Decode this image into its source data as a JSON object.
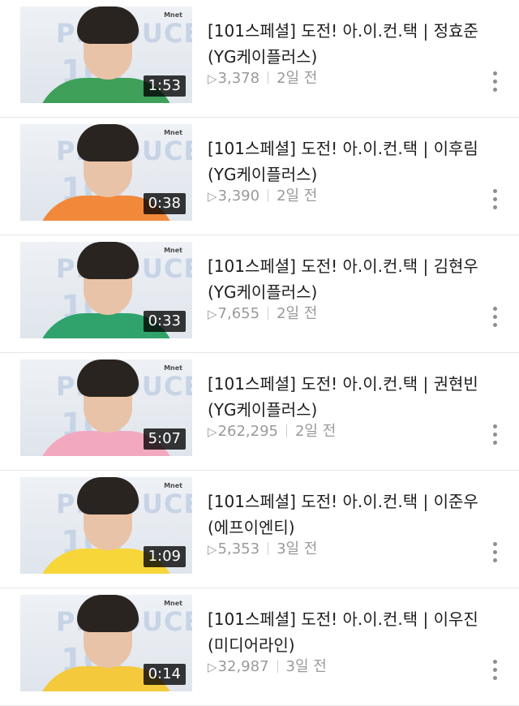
{
  "videos": [
    {
      "title": "[101스페셜] 도전! 아.이.컨.택 | 정효준 (YG케이플러스)",
      "duration": "1:53",
      "views": "3,378",
      "age": "2일 전",
      "shirt_color": "#3fa05a"
    },
    {
      "title": "[101스페셜] 도전! 아.이.컨.택 | 이후림 (YG케이플러스)",
      "duration": "0:38",
      "views": "3,390",
      "age": "2일 전",
      "shirt_color": "#f2893a"
    },
    {
      "title": "[101스페셜] 도전! 아.이.컨.택 | 김현우 (YG케이플러스)",
      "duration": "0:33",
      "views": "7,655",
      "age": "2일 전",
      "shirt_color": "#2fa36b"
    },
    {
      "title": "[101스페셜] 도전! 아.이.컨.택 | 권현빈 (YG케이플러스)",
      "duration": "5:07",
      "views": "262,295",
      "age": "2일 전",
      "shirt_color": "#f2a9c0"
    },
    {
      "title": "[101스페셜] 도전! 아.이.컨.택 | 이준우 (에프이엔티)",
      "duration": "1:09",
      "views": "5,353",
      "age": "3일 전",
      "shirt_color": "#f7d63a"
    },
    {
      "title": "[101스페셜] 도전! 아.이.컨.택 | 이우진 (미디어라인)",
      "duration": "0:14",
      "views": "32,987",
      "age": "3일 전",
      "shirt_color": "#f4c93b"
    }
  ],
  "thumbnail": {
    "logo_text": "PRODUCE",
    "logo_number": "101",
    "channel_mark": "Mnet"
  },
  "icons": {
    "play": "play-triangle-icon",
    "more": "more-vertical-icon"
  }
}
